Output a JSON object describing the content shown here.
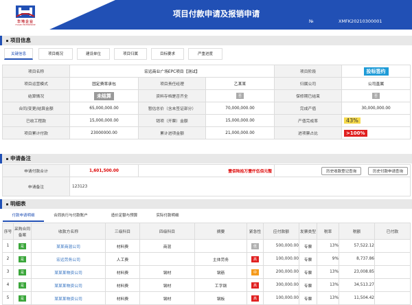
{
  "header": {
    "logo_brand": "华地企业",
    "logo_brand_en": "HUADI ENTERPRISE",
    "title": "项目付款申请及报销申请",
    "no_label": "№",
    "no_value": "XMFK20210300001"
  },
  "project_section": {
    "heading": "项目信息",
    "tabs": [
      "关键信息",
      "项目概况",
      "建设单位",
      "项目归属",
      "目标要求",
      "严重进度"
    ],
    "rows": [
      [
        "项目名称",
        "宏远商业广场EPC项目【测试】",
        "项目阶段",
        "投标签约"
      ],
      [
        "项目运营模式",
        "固定费率承包",
        "项目责任经理",
        "乙某某",
        "归属公司",
        "公司直属"
      ],
      [
        "结算情况",
        "未结算",
        "资料存档是否齐全",
        "否",
        "保修期已结束",
        "否"
      ],
      [
        "合同/变更/结算金额",
        "65,000,000.00",
        "暂估总价（含未签证部分）",
        "70,000,000.00",
        "完成产值",
        "30,000,000.00"
      ],
      [
        "已收工程款",
        "15,000,000.00",
        "销项（开票）金额",
        "15,000,000.00",
        "产值完成率",
        "43%"
      ],
      [
        "项目累计付款",
        "23000000.00",
        "累计进项金额",
        "21,000,000.00",
        "进项票占比",
        ">100%"
      ]
    ]
  },
  "request_section": {
    "heading": "申请备注",
    "total_label": "申请付款合计",
    "total_value": "1,601,500.00",
    "total_cn": "壹佰陆拾万壹仟伍佰元整",
    "btn_history_receipt": "历史收款登记查询",
    "btn_history_payment": "历史付款申请查询",
    "note_label": "申请备注",
    "note_value": "123123"
  },
  "detail_section": {
    "heading": "明细表",
    "tabs": [
      "付款申请明细",
      "合同执行与付款账户",
      "造价定额与预算",
      "实际付款明细"
    ],
    "columns": [
      "序号",
      "采购合同备案",
      "收款方名称",
      "三级科目",
      "四级科目",
      "摘要",
      "紧急性",
      "应付款额",
      "发票类型",
      "税率",
      "税额",
      "已付款"
    ],
    "rows": [
      {
        "idx": "1",
        "filed": "是",
        "payee": "某某商混公司",
        "l3": "材料费",
        "l4": "商混",
        "summary": "",
        "urgency": "低",
        "amount": "500,000.00",
        "invoice": "专票",
        "rate": "13%",
        "tax": "57,522.12",
        "paid": ""
      },
      {
        "idx": "2",
        "filed": "是",
        "payee": "宏远劳务公司",
        "l3": "人工费",
        "l4": "",
        "summary": "主体劳务",
        "urgency": "高",
        "amount": "100,000.00",
        "invoice": "专票",
        "rate": "9%",
        "tax": "8,737.86",
        "paid": ""
      },
      {
        "idx": "3",
        "filed": "是",
        "payee": "某某某物资公司",
        "l3": "材料费",
        "l4": "钢材",
        "summary": "钢筋",
        "urgency": "中",
        "amount": "200,000.00",
        "invoice": "专票",
        "rate": "13%",
        "tax": "23,008.85",
        "paid": ""
      },
      {
        "idx": "4",
        "filed": "是",
        "payee": "某某某物资公司",
        "l3": "材料费",
        "l4": "钢材",
        "summary": "工字钢",
        "urgency": "高",
        "amount": "300,000.00",
        "invoice": "专票",
        "rate": "13%",
        "tax": "34,513.27",
        "paid": ""
      },
      {
        "idx": "5",
        "filed": "是",
        "payee": "某某某物资公司",
        "l3": "材料费",
        "l4": "钢材",
        "summary": "钢板",
        "urgency": "高",
        "amount": "100,000.00",
        "invoice": "专票",
        "rate": "13%",
        "tax": "11,504.42",
        "paid": ""
      }
    ]
  }
}
